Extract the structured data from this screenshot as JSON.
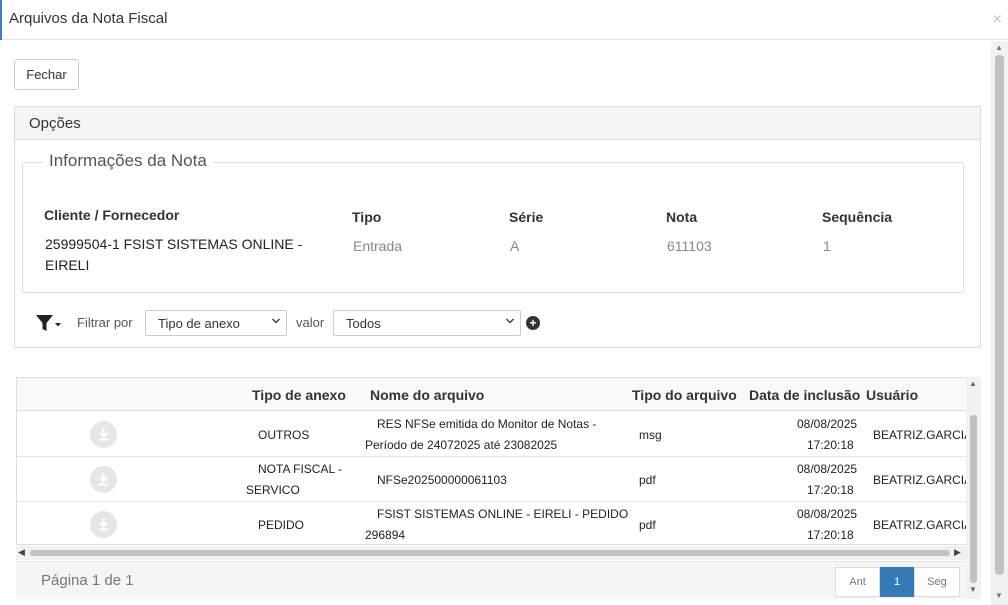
{
  "modal": {
    "title": "Arquivos da Nota Fiscal",
    "close_glyph": "×"
  },
  "toolbar": {
    "close_label": "Fechar"
  },
  "panel": {
    "title": "Opções"
  },
  "info": {
    "legend": "Informações da Nota",
    "headers": {
      "cliente": "Cliente / Fornecedor",
      "tipo": "Tipo",
      "serie": "Série",
      "nota": "Nota",
      "sequencia": "Sequência"
    },
    "values": {
      "cliente": "25999504-1 FSIST SISTEMAS ONLINE - EIRELI",
      "tipo": "Entrada",
      "serie": "A",
      "nota": "611103",
      "sequencia": "1"
    }
  },
  "filter": {
    "icon": "filter-dropdown-icon",
    "filter_label": "Filtrar por",
    "filter_select": "Tipo de anexo",
    "value_label": "valor",
    "value_select": "Todos",
    "add_icon": "plus-circle-icon",
    "add_glyph": "+"
  },
  "grid": {
    "columns": [
      "",
      "Tipo de anexo",
      "Nome do arquivo",
      "Tipo do arquivo",
      "Data de inclusão",
      "Usuário"
    ],
    "rows": [
      {
        "tipo_anexo": [
          "OUTROS"
        ],
        "nome": [
          "RES NFSe emitida do Monitor de Notas -",
          "Período de 24072025 até 23082025"
        ],
        "tipo_arquivo": "msg",
        "data": [
          "08/08/2025",
          "17:20:18"
        ],
        "usuario": "BEATRIZ.GARCIA"
      },
      {
        "tipo_anexo": [
          "NOTA FISCAL -",
          "SERVICO"
        ],
        "nome": [
          "NFSe202500000061103"
        ],
        "tipo_arquivo": "pdf",
        "data": [
          "08/08/2025",
          "17:20:18"
        ],
        "usuario": "BEATRIZ.GARCIA"
      },
      {
        "tipo_anexo": [
          "PEDIDO"
        ],
        "nome": [
          "FSIST SISTEMAS ONLINE - EIRELI - PEDIDO",
          "296894"
        ],
        "tipo_arquivo": "pdf",
        "data": [
          "08/08/2025",
          "17:20:18"
        ],
        "usuario": "BEATRIZ.GARCIA"
      }
    ]
  },
  "pager": {
    "text": "Página 1 de 1",
    "prev": "Ant",
    "current": "1",
    "next": "Seg"
  },
  "colors": {
    "accent": "#337ab7",
    "border": "#dddddd",
    "panel_bg": "#f5f5f5"
  }
}
